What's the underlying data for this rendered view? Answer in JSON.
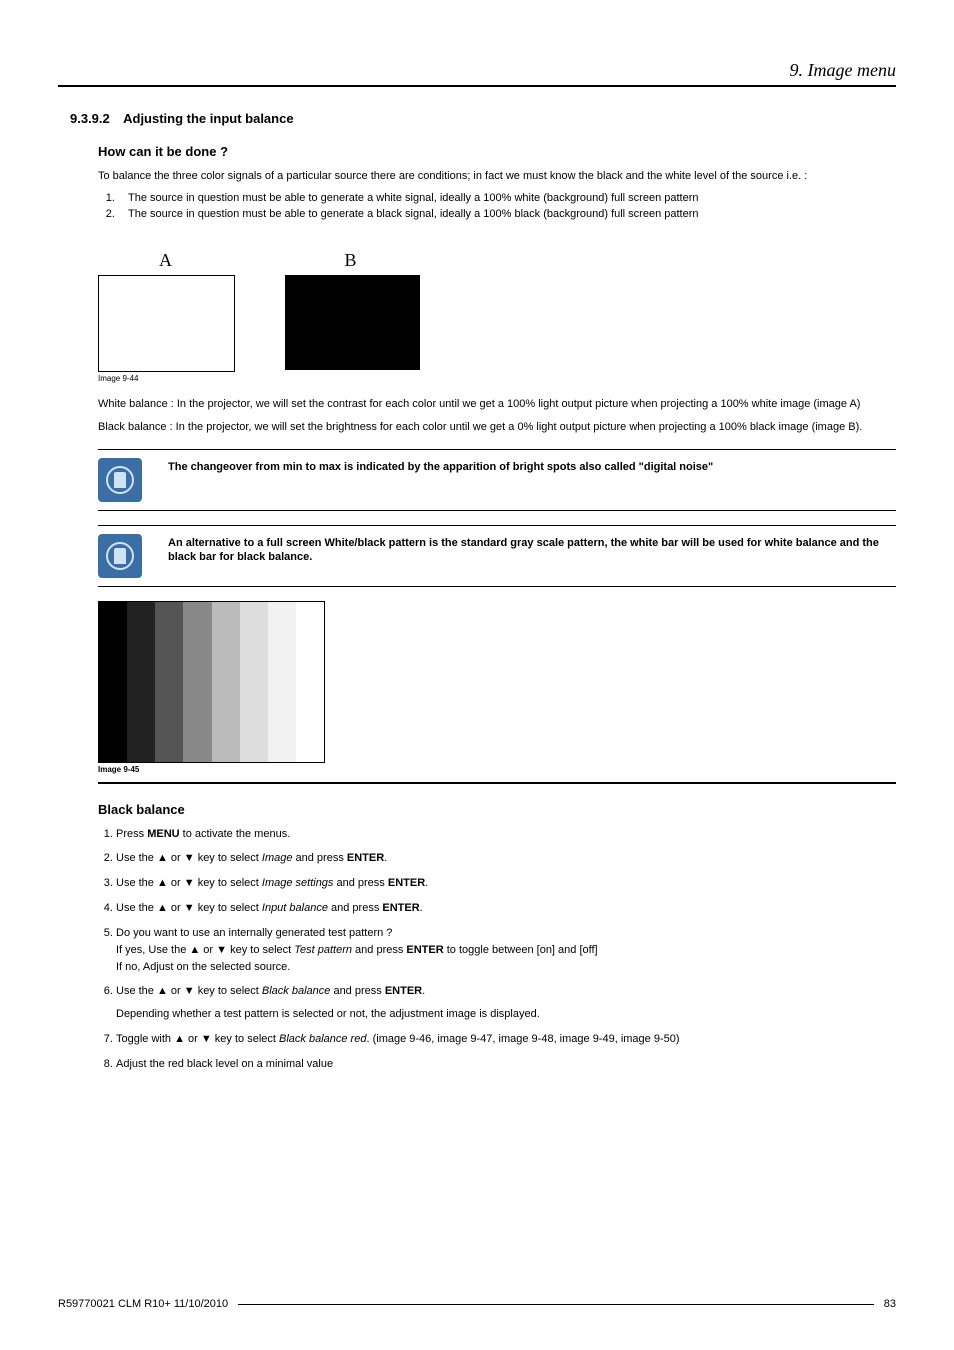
{
  "header": {
    "chapter": "9. Image menu"
  },
  "section": {
    "number": "9.3.9.2",
    "title": "Adjusting the input balance"
  },
  "sub1": {
    "heading": "How can it be done ?",
    "intro": "To balance the three color signals of a particular source there are conditions; in fact we must know the black and the white level of the source i.e.  :",
    "cond1": "The source in question must be able to generate a white signal, ideally a 100% white (background) full screen pattern",
    "cond2": "The source in question must be able to generate a black signal, ideally a 100% black (background) full screen pattern"
  },
  "fig1": {
    "labelA": "A",
    "labelB": "B",
    "caption": "Image 9-44"
  },
  "para_white": "White balance : In the projector, we will set the contrast for each color until we get a 100% light output picture when projecting a 100% white image (image A)",
  "para_black": "Black balance : In the projector, we will set the brightness for each color until we get a 0% light output picture when projecting a 100% black image (image B).",
  "note1": "The changeover from min to max is indicated by the apparition of bright spots also called \"digital noise\"",
  "note2": "An alternative to a full screen White/black pattern is the standard gray scale pattern, the white bar will be used for white balance and the black bar for black balance.",
  "fig2": {
    "caption": "Image 9-45"
  },
  "sub2": {
    "heading": "Black balance",
    "steps": [
      {
        "pre": "Press ",
        "bold": "MENU",
        "post": " to activate the menus."
      },
      {
        "pre": "Use the ▲ or ▼ key to select ",
        "ital": "Image",
        "mid": " and press ",
        "bold": "ENTER",
        "post": "."
      },
      {
        "pre": "Use the ▲ or ▼ key to select ",
        "ital": "Image settings",
        "mid": " and press ",
        "bold": "ENTER",
        "post": "."
      },
      {
        "pre": "Use the ▲ or ▼ key to select ",
        "ital": "Input balance",
        "mid": " and press ",
        "bold": "ENTER",
        "post": "."
      },
      {
        "line1": "Do you want to use an internally generated test pattern ?",
        "line2_pre": "If yes, Use the ▲ or ▼ key to select ",
        "line2_ital": "Test pattern",
        "line2_mid": " and press ",
        "line2_bold": "ENTER",
        "line2_post": " to toggle between [on] and [off]",
        "line3": "If no, Adjust on the selected source."
      },
      {
        "pre": "Use the ▲ or ▼ key to select ",
        "ital": "Black balance",
        "mid": " and press ",
        "bold": "ENTER",
        "post": ".",
        "extra": "Depending whether a test pattern is selected or not, the adjustment image is displayed."
      },
      {
        "pre": "Toggle with ▲ or ▼ key to select ",
        "ital": "Black balance red",
        "post": ". (image 9-46, image 9-47, image 9-48, image 9-49, image 9-50)"
      },
      {
        "pre": "Adjust the red black level on a minimal value"
      }
    ]
  },
  "footer": {
    "left": "R59770021  CLM R10+  11/10/2010",
    "page": "83"
  }
}
